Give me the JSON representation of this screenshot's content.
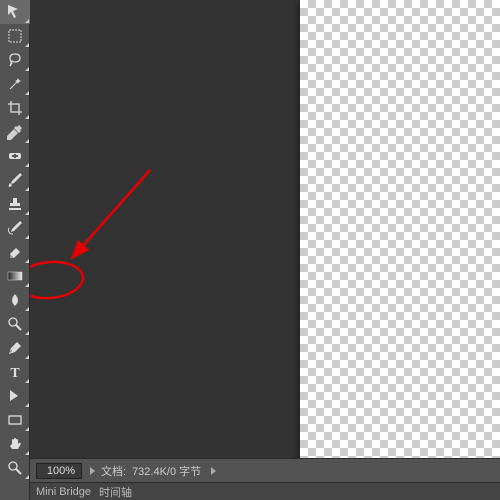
{
  "tools": [
    {
      "id": "move",
      "label": "Move Tool"
    },
    {
      "id": "marquee",
      "label": "Rectangular Marquee"
    },
    {
      "id": "lasso",
      "label": "Lasso"
    },
    {
      "id": "wand",
      "label": "Magic Wand"
    },
    {
      "id": "crop",
      "label": "Crop"
    },
    {
      "id": "eyedropper",
      "label": "Eyedropper"
    },
    {
      "id": "heal",
      "label": "Spot Healing"
    },
    {
      "id": "brush",
      "label": "Brush"
    },
    {
      "id": "stamp",
      "label": "Clone Stamp"
    },
    {
      "id": "history",
      "label": "History Brush"
    },
    {
      "id": "eraser",
      "label": "Eraser"
    },
    {
      "id": "gradient",
      "label": "Gradient"
    },
    {
      "id": "blur",
      "label": "Blur"
    },
    {
      "id": "dodge",
      "label": "Dodge"
    },
    {
      "id": "pen",
      "label": "Pen"
    },
    {
      "id": "type",
      "label": "Type"
    },
    {
      "id": "path",
      "label": "Path Selection"
    },
    {
      "id": "shape",
      "label": "Rectangle Shape"
    },
    {
      "id": "hand",
      "label": "Hand"
    },
    {
      "id": "zoom",
      "label": "Zoom"
    }
  ],
  "statusbar": {
    "zoom": "100%",
    "doc_label": "文档:",
    "doc_size": "732.4K/0 字节"
  },
  "bottom_tabs": {
    "mini_bridge": "Mini Bridge",
    "timeline": "时间轴"
  },
  "annotation": {
    "target_tool": "gradient"
  }
}
